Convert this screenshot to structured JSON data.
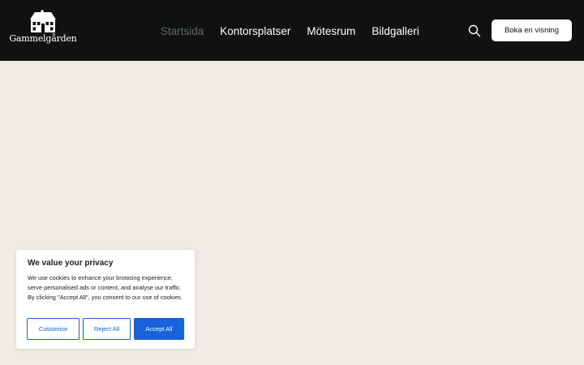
{
  "brand": {
    "name": "Gammelgården"
  },
  "nav": {
    "items": [
      {
        "label": "Startsida",
        "active": true
      },
      {
        "label": "Kontorsplatser",
        "active": false
      },
      {
        "label": "Mötesrum",
        "active": false
      },
      {
        "label": "Bildgalleri",
        "active": false
      }
    ]
  },
  "header": {
    "search_icon": "search-icon",
    "cta_label": "Boka en visning"
  },
  "cookie_banner": {
    "title": "We value your privacy",
    "text": "We use cookies to enhance your browsing experience, serve personalised ads or content, and analyse our traffic. By clicking \"Accept All\", you consent to our use of cookies.",
    "buttons": {
      "customise": "Customise",
      "reject": "Reject All",
      "accept": "Accept All"
    }
  },
  "colors": {
    "header_bg": "#111111",
    "page_bg": "#efebe5",
    "nav_active": "#5d6b66",
    "accent": "#1863dc"
  }
}
